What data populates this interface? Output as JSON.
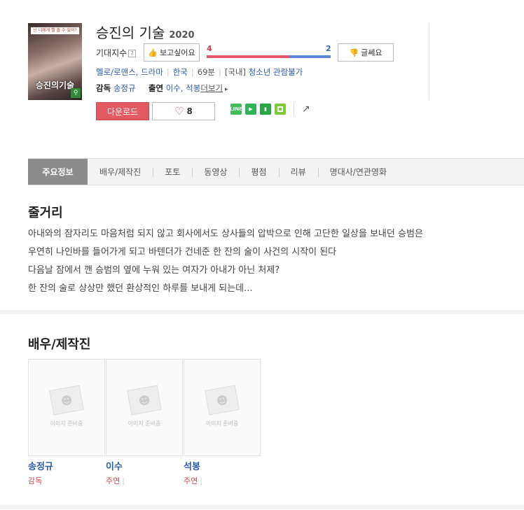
{
  "movie": {
    "title": "승진의 기술",
    "year": "2020",
    "poster": {
      "tag": "난 너에게 빨 줄 수 있어?",
      "title": "승진의기술",
      "icon": "search-icon"
    },
    "expect": {
      "label": "기대지수",
      "help": "?",
      "like_label": "보고싶어요",
      "dislike_label": "글쎄요",
      "like_count": "4",
      "dislike_count": "2",
      "like_ratio": 0.667
    },
    "meta": {
      "genre": "멜로/로맨스, 드라마",
      "country": "한국",
      "runtime": "69분",
      "rating_prefix": "[국내]",
      "rating": "청소년 관람불가"
    },
    "staff": {
      "director_label": "감독",
      "director": "송정규",
      "cast_label": "출연",
      "cast": "이수, 석봉",
      "more": "더보기"
    },
    "actions": {
      "download": "다운로드",
      "like_count": "8"
    },
    "share_icons": [
      {
        "name": "line-icon",
        "color": "#3fbf5a"
      },
      {
        "name": "band-icon",
        "color": "#2fb556"
      },
      {
        "name": "bookmark-icon",
        "color": "#28a745"
      },
      {
        "name": "square-icon",
        "color": "#7ccd3a"
      }
    ]
  },
  "tabs": [
    "주요정보",
    "배우/제작진",
    "포토",
    "동영상",
    "평점",
    "리뷰",
    "명대사/연관영화"
  ],
  "synopsis": {
    "title": "줄거리",
    "lines": [
      "아내와의 잠자리도 마음처럼 되지 않고 회사에서도 상사들의 압박으로 인해 고단한 일상을 보내던 승범은",
      " 우연히 나인바를 들어가게 되고 바텐더가 건네준 한 잔의 술이 사건의 시작이 된다",
      " 다음날 잠에서 깬 승범의 옆에 누워 있는 여자가 아내가 아닌 처제?",
      " 한 잔의 술로 상상만 했던 환상적인 하루를 보내게 되는데..."
    ]
  },
  "cast_section": {
    "title": "배우/제작진",
    "placeholder": "이미지 준비중",
    "members": [
      {
        "name": "송정규",
        "role": "감독",
        "bar": ""
      },
      {
        "name": "이수",
        "role": "주연",
        "bar": "|"
      },
      {
        "name": "석봉",
        "role": "주연",
        "bar": "|"
      }
    ]
  }
}
